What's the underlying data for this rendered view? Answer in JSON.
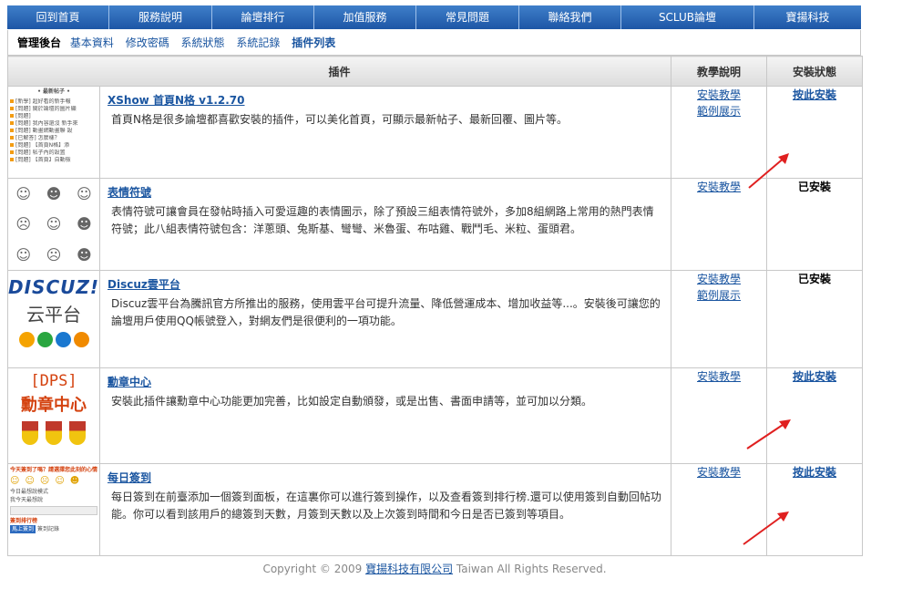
{
  "top_nav": [
    "回到首頁",
    "服務說明",
    "論壇排行",
    "加值服務",
    "常見問題",
    "聯絡我們",
    "SCLUB論壇",
    "寶揚科技"
  ],
  "sub_nav": {
    "admin": "管理後台",
    "links": [
      "基本資料",
      "修改密碼",
      "系統狀態",
      "系統記錄",
      "插件列表"
    ]
  },
  "table": {
    "headers": [
      "插件",
      "教學說明",
      "安裝狀態"
    ],
    "rows": [
      {
        "name": "XShow 首頁N格 v1.2.70",
        "desc": "首頁N格是很多論壇都喜歡安裝的插件，可以美化首頁，可顯示最新帖子、最新回覆、圖片等。",
        "tutorials": [
          "安裝教學",
          "範例展示"
        ],
        "status": "按此安裝",
        "installed": false
      },
      {
        "name": "表情符號",
        "desc": "表情符號可讓會員在發帖時插入可愛逗趣的表情圖示，除了預設三組表情符號外，多加8組網路上常用的熱門表情符號；此八組表情符號包含：洋蔥頭、兔斯基、彎彎、米魯蛋、布咕雞、戰鬥毛、米粒、蛋頭君。",
        "tutorials": [
          "安裝教學"
        ],
        "status": "已安裝",
        "installed": true
      },
      {
        "name": "Discuz雲平台",
        "desc": "Discuz雲平台為騰訊官方所推出的服務，使用雲平台可提升流量、降低營運成本、增加收益等...。安裝後可讓您的論壇用戶使用QQ帳號登入，對網友們是很便利的一項功能。",
        "tutorials": [
          "安裝教學",
          "範例展示"
        ],
        "status": "已安裝",
        "installed": true
      },
      {
        "name": "勳章中心",
        "desc": "安裝此插件讓勳章中心功能更加完善，比如設定自動頒發，或是出售、書面申請等，並可加以分類。",
        "tutorials": [
          "安裝教學"
        ],
        "status": "按此安裝",
        "installed": false
      },
      {
        "name": "每日簽到",
        "desc": "每日簽到在前臺添加一個簽到面板，在這裏你可以進行簽到操作，以及查看簽到排行榜.還可以使用簽到自動回帖功能。你可以看到該用戶的總簽到天數，月簽到天數以及上次簽到時間和今日是否已簽到等項目。",
        "tutorials": [
          "安裝教學"
        ],
        "status": "按此安裝",
        "installed": false
      }
    ]
  },
  "thumbs": {
    "t1": {
      "title": "• 最新帖子 •",
      "rows": [
        "[新學] 超好看的新手報",
        "[問題] 關於論壇的圖片顯",
        "[問題]",
        "[問題] 我內容還沒 新手來",
        "[問題] 動畫網動畫聯 設",
        "[已解答] 怎麼樣？",
        "[問題] 【首頁N格】添",
        "[問題] 帖子內的設置",
        "[問題] 【首頁】自動檢"
      ]
    },
    "t3": {
      "l1": "DISCUZ!",
      "l2": "云平台"
    },
    "t4": {
      "l1": "[DPS]",
      "l2": "勳章中心"
    },
    "t5": {
      "title": "今天簽到了嗎？請選擇您此刻的心情",
      "l1": "今日最想說模式",
      "l2": "我今天最想說",
      "l3": "簽到排行榜",
      "btn": "馬上簽到",
      "btn2": "簽到記錄"
    }
  },
  "footer": {
    "prefix": "Copyright © 2009 ",
    "company": "寶揚科技有限公司",
    "suffix": " Taiwan All Rights Reserved."
  },
  "colors": {
    "nav_bg": "#2b68b5",
    "link": "#1a55a0",
    "arrow": "#e02020"
  }
}
